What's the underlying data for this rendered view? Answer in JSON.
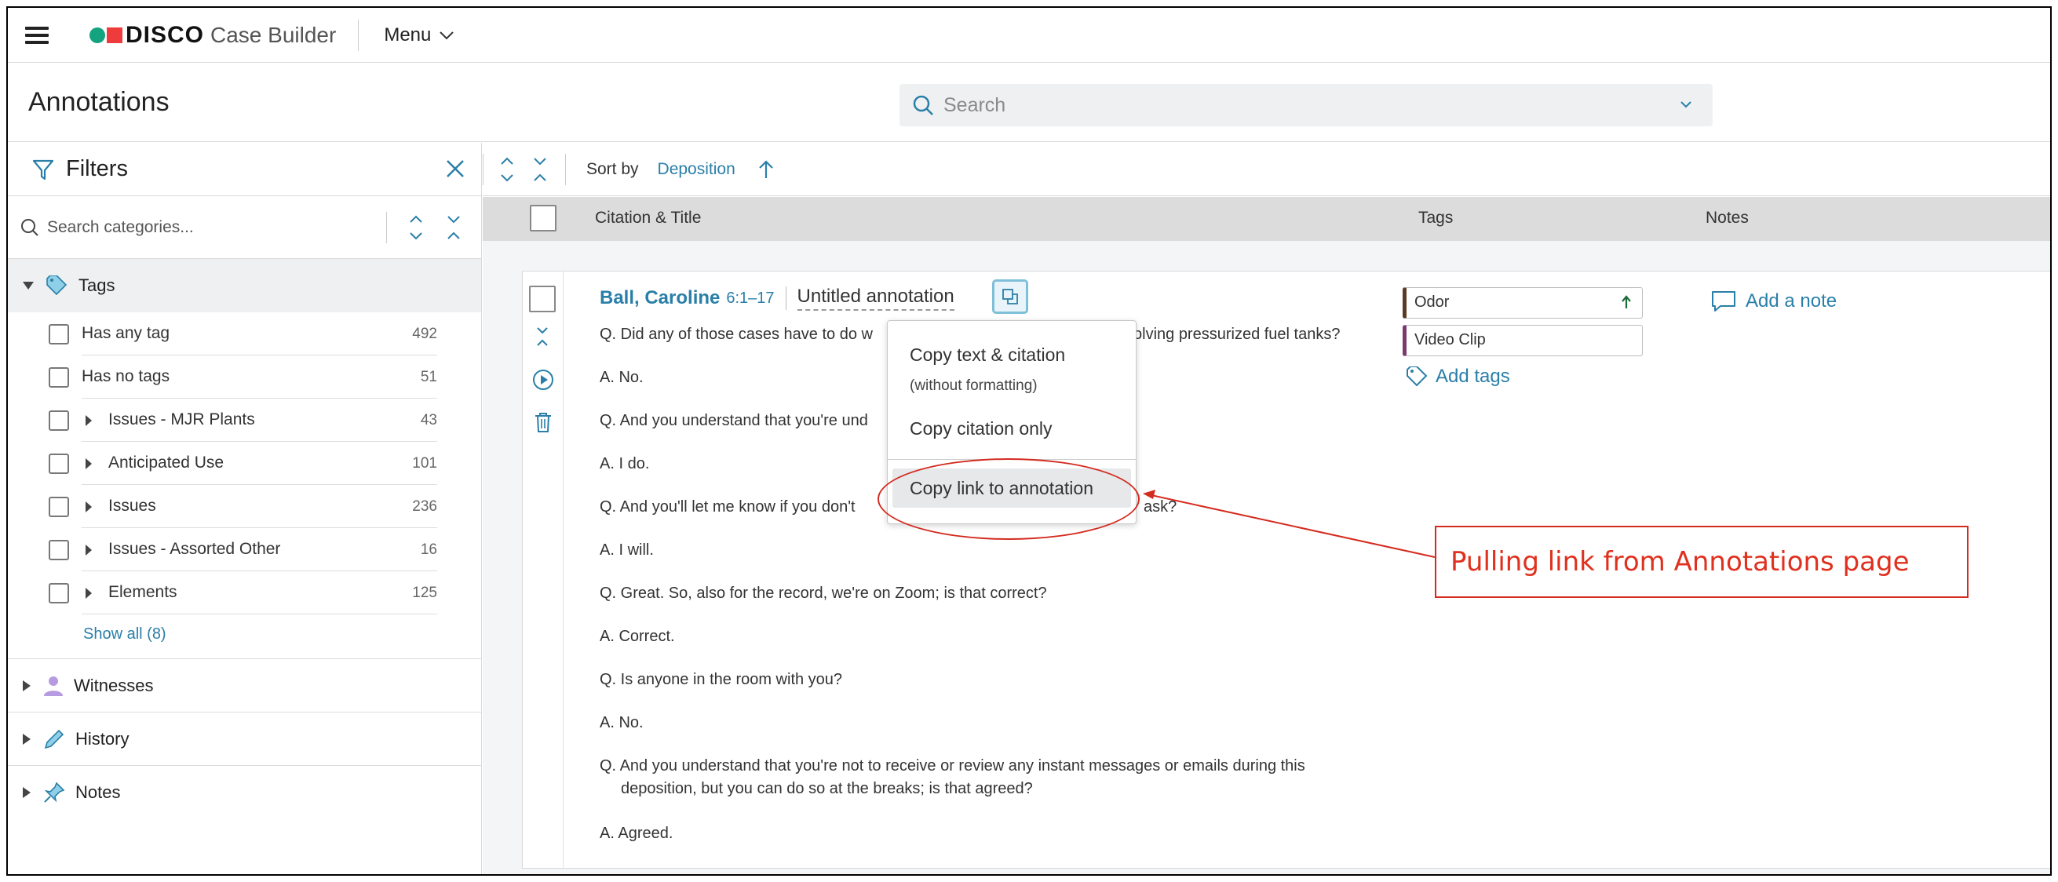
{
  "app": {
    "brand": "DISCO",
    "product": "Case Builder",
    "menu_label": "Menu"
  },
  "page": {
    "title": "Annotations",
    "search_placeholder": "Search"
  },
  "filters": {
    "title": "Filters",
    "category_search_placeholder": "Search categories...",
    "sections": {
      "tags": "Tags",
      "witnesses": "Witnesses",
      "history": "History",
      "notes": "Notes"
    },
    "tag_items": [
      {
        "label": "Has any tag",
        "count": "492",
        "expandable": false
      },
      {
        "label": "Has no tags",
        "count": "51",
        "expandable": false
      },
      {
        "label": "Issues - MJR Plants",
        "count": "43",
        "expandable": true
      },
      {
        "label": "Anticipated Use",
        "count": "101",
        "expandable": true
      },
      {
        "label": "Issues",
        "count": "236",
        "expandable": true
      },
      {
        "label": "Issues - Assorted Other",
        "count": "16",
        "expandable": true
      },
      {
        "label": "Elements",
        "count": "125",
        "expandable": true
      }
    ],
    "show_all": "Show all (8)"
  },
  "list": {
    "sort_label": "Sort by",
    "sort_value": "Deposition",
    "columns": {
      "citation": "Citation & Title",
      "tags": "Tags",
      "notes": "Notes"
    }
  },
  "annotation": {
    "witness": "Ball, Caroline",
    "pages": "6:1–17",
    "title": "Untitled annotation",
    "lines": [
      "Q. Did any of those cases have to do w",
      "olving pressurized fuel tanks?",
      "A. No.",
      "Q. And you understand that you're und",
      "A. I do.",
      "Q. And you'll let me know if you don't",
      "ask?",
      "A. I will.",
      "Q. Great. So, also for the record, we're on Zoom; is that correct?",
      "A. Correct.",
      "Q. Is anyone in the room with you?",
      "A. No.",
      "Q. And you understand that you're not to receive or review any instant messages or emails during this",
      "deposition, but you can do so at the breaks; is that agreed?",
      "A. Agreed."
    ],
    "tags": [
      "Odor",
      "Video Clip"
    ],
    "add_tags": "Add tags",
    "add_note": "Add a note"
  },
  "copy_menu": {
    "item1": "Copy text & citation",
    "item1_sub": "(without formatting)",
    "item2": "Copy citation only",
    "item3": "Copy link to annotation"
  },
  "callout": {
    "text": "Pulling link from Annotations page"
  },
  "colors": {
    "accent": "#2a7fa8",
    "annotation_red": "#d42b1f",
    "tag_odor": "#5a3a23",
    "tag_video": "#7a3a6f"
  }
}
